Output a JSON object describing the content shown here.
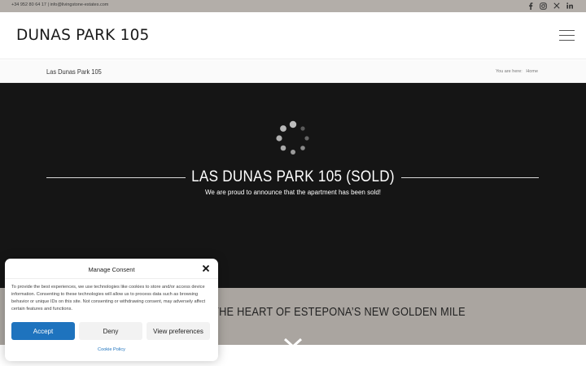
{
  "topbar": {
    "contact": "+34 952 80 64 17 | info@livingstone-estates.com",
    "social": [
      "facebook-icon",
      "instagram-icon",
      "x-icon",
      "linkedin-icon"
    ]
  },
  "header": {
    "logo": "DUNAS PARK 105",
    "menu_icon": "hamburger-icon"
  },
  "titlebar": {
    "title": "Las Dunas Park 105",
    "breadcrumb_prefix": "You are here:",
    "breadcrumb_home": "Home"
  },
  "hero": {
    "title": "LAS DUNAS PARK 105 (SOLD)",
    "subtitle": "We are proud to announce that the apartment has been sold!"
  },
  "band": {
    "text": "FRONT LIVING IN THE HEART OF ESTEPONA’S NEW GOLDEN MILE"
  },
  "consent": {
    "title": "Manage Consent",
    "body": "To provide the best experiences, we use technologies like cookies to store and/or access device information. Consenting to these technologies will allow us to process data such as browsing behavior or unique IDs on this site. Not consenting or withdrawing consent, may adversely affect certain features and functions.",
    "accept_label": "Accept",
    "deny_label": "Deny",
    "prefs_label": "View preferences",
    "policy_label": "Cookie Policy"
  },
  "colors": {
    "topbar": "#b3aea9",
    "hero_bg": "#151515",
    "band": "#aaa5a0",
    "accent": "#1e73be"
  }
}
